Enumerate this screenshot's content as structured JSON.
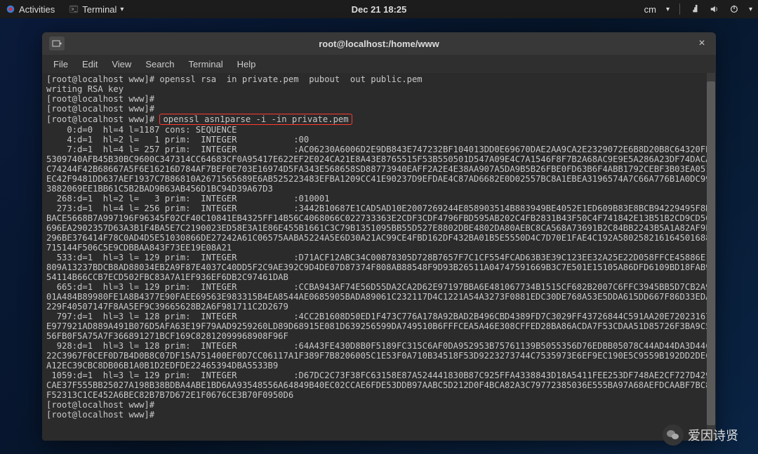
{
  "topbar": {
    "activities": "Activities",
    "app_label": "Terminal",
    "datetime": "Dec 21  18:25",
    "user_label": "cm",
    "user_chevron": "▾"
  },
  "window": {
    "title": "root@localhost:/home/www",
    "close": "×"
  },
  "menubar": {
    "file": "File",
    "edit": "Edit",
    "view": "View",
    "search": "Search",
    "terminal": "Terminal",
    "help": "Help"
  },
  "terminal": {
    "line0": "[root@localhost www]# openssl rsa  in private.pem  pubout  out public.pem",
    "line1": "writing RSA key",
    "line2": "[root@localhost www]#",
    "line3": "[root@localhost www]#",
    "prompt4": "[root@localhost www]# ",
    "cmd4": "openssl asn1parse -i -in private.pem",
    "body": "    0:d=0  hl=4 l=1187 cons: SEQUENCE\n    4:d=1  hl=2 l=   1 prim:  INTEGER           :00\n    7:d=1  hl=4 l= 257 prim:  INTEGER           :AC06230A6006D2E9DB843E747232BF104013DD0E69670DAE2AA9CA2E2329072E6B8D20B8C64320FB5309740AFB45B30BC9600C347314CC64683CF0A95417E622EF2E024CA21E8A43E8765515F53B550501D547A09E4C7A1546F8F7B2A68AC9E9E5A286A23DF74DACAC74244F42B68667A5F6E16216D784AF7BEF0E703E16974D5FA343E568658SD88773940EAFF2A2E4E38AA907A5DA9B5B26FBE0FD63B6F4ABB1792CEBF3B03EA051EC42F9481DD637AEF1937C7B86810A2671565689E6AB525223483EFBA1209CC41E90237D9EFDAE4C87AD6682E0D02557BC8A1EBEA3196574A7C66A776B1A0DC993882069EE1BB61C5B2BAD9B63AB456D1BC94D39A67D3\n  268:d=1  hl=2 l=   3 prim:  INTEGER           :010001\n  273:d=1  hl=4 l= 256 prim:  INTEGER           :3442B10687E1CAD5AD10E2007269244E858903514B883949BE4052E1ED609B83E8BCB94229495F8DBACE5668B7A997196F96345F02CF40C10841EB4325FF14B56C4068066C022733363E2CDF3CDF4796FBD595AB202C4FB2831B43F50C4F741842E13B51B2CD9CD56696EA2902357D63A3B1F4BA5E7C2190023ED58E3A1E86E455B1661C3C79B1351095BB55D527E8802DBE4802DA80AEBC8CA568A73691B2C84BB2243B5A1A82AF9E296BE376414F78C0AD4D5E51030866DE27242A61C06575AABA5224A5E6D30A21AC99CE4FBD162DF432BA01B5E5550D4C7D70E1FAE4C192A580258216164501688715144F506C5E9CDBBAA843F73EE19E08A21\n  533:d=1  hl=3 l= 129 prim:  INTEGER           :D71ACF12ABC34C00878305D728B7657F7C1CF554FCAD63B3E39C123EE32A25E22D058FFCE45886E1809A13237BDCB8AD88034EB2A9F87E4037C40DD5F2C9AE392C9D4DE07D87374F808AB88548F9D93B26511A04747591669B3C7E501E15105A86DFD6109BD18FAB954114B66CCB7ECD502FBC83A7A1EF936EF6DB2C97461DAB\n  665:d=1  hl=3 l= 129 prim:  INTEGER           :CCBA943AF74E56D55DA2CA2D62E97197BBA6E481067734B1515CF682B2007C6FFC3945BB5D7CB2A901A484B89980FE1A8B4377E90FAEE69563E983315B4EA8544AE0685905BADA89061C232117D4C1221A54A3273F0881EDC30DE768A53E5DDA615DD667F86D33EDA229F40507147F8AA5EF9C39665628B2A6F981711C2D2679\n  797:d=1  hl=3 l= 128 prim:  INTEGER           :4CC2B1608D50ED1F473C776A178A92BAD2B496CBD4389FD7C3029FF43726844C591AA20E72023167E977921AD889A491B076D5AFA63E19F79AAD9259260LD89D68915E081D639256599DA749510B6FFFCEA5A46E308CFFED28BA86ACDA7F53CDAA51D85726F3BA9C556FB0F5A75A7F366891271BCF169C82812099968908F96F\n  928:d=1  hl=3 l= 128 prim:  INTEGER           :64A43FE430D8B0F5189FC315C6AF0DA952953B75761139B5055356D76EDBB05078C44AD44DA3D44C22C3967F0CEF0D7B4D0B8C07DF15A751400EF0D7CC06117A1F389F7B8206005C1E53F0A710B34518F53D9223273744C7535973E6EF9EC190E5C9559B192DD2DECA12EC39CBC8DB06B1A0B1D2EDFDE22465394DBA5533B9\n 1059:d=1  hl=3 l= 129 prim:  INTEGER           :D67DC2C73F38FC63158E87A524441830B87C925FFA4338843D18A5411FEE253DF748AE2CF727D429CAE37F555BB25027A198B38BDBA4ABE1BD6AA93548556A64849B40EC02CCAE6FDE53DDB97AABC5D212D0F4BCA82A3C79772385036E555BA97A68AEFDCAABF7BC8F52313C1CE452A6BEC82B7B7D672E1F0676CE3B70F0950D6\n[root@localhost www]#\n[root@localhost www]#"
  },
  "watermark": {
    "label": "爱因诗贤"
  }
}
